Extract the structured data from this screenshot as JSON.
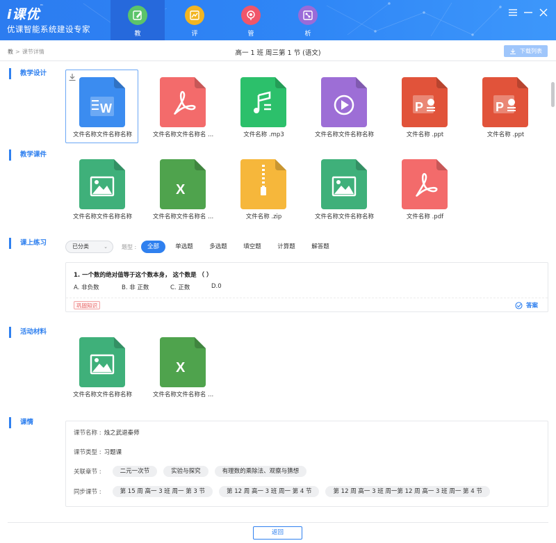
{
  "app": {
    "logo_main": "i课优",
    "logo_tm": "™",
    "logo_sub": "优课智能系统建设专家"
  },
  "nav": [
    {
      "label": "教",
      "color": "#5cc46a",
      "icon": "edit-icon"
    },
    {
      "label": "评",
      "color": "#f2b521",
      "icon": "chart-icon"
    },
    {
      "label": "管",
      "color": "#f0566a",
      "icon": "brain-icon"
    },
    {
      "label": "析",
      "color": "#9a6bd8",
      "icon": "analysis-icon"
    }
  ],
  "breadcrumb": {
    "root": "教",
    "sep": ">",
    "current": "课节详情"
  },
  "page_title": "高一 1 班 周三第 1 节 (语文)",
  "download_list_label": "下载列表",
  "sections": {
    "design": "教学设计",
    "courseware": "教学课件",
    "exercise": "课上练习",
    "activity": "活动材料",
    "situation": "课情"
  },
  "design_files": [
    {
      "name": "文件名称文件名称名称",
      "type": "word",
      "color": "#3b8cf0"
    },
    {
      "name": "文件名称文件名称名 ...",
      "type": "pdf",
      "color": "#f36b6b"
    },
    {
      "name": "文件名称 .mp3",
      "type": "audio",
      "color": "#2cc06b"
    },
    {
      "name": "文件名称文件名称名称",
      "type": "video",
      "color": "#9d6ed6"
    },
    {
      "name": "文件名称 .ppt",
      "type": "ppt",
      "color": "#e1533a"
    },
    {
      "name": "文件名称 .ppt",
      "type": "ppt",
      "color": "#e1533a"
    }
  ],
  "courseware_files": [
    {
      "name": "文件名称文件名称名称",
      "type": "image",
      "color": "#3fb07a"
    },
    {
      "name": "文件名称文件名称名 ...",
      "type": "excel",
      "color": "#4fa34d"
    },
    {
      "name": "文件名称 .zip",
      "type": "zip",
      "color": "#f6b73b"
    },
    {
      "name": "文件名称文件名称名称",
      "type": "image",
      "color": "#3fb07a"
    },
    {
      "name": "文件名称 .pdf",
      "type": "pdf",
      "color": "#f36b6b"
    }
  ],
  "activity_files": [
    {
      "name": "文件名称文件名称名称",
      "type": "image",
      "color": "#3fb07a"
    },
    {
      "name": "文件名称文件名称名 ...",
      "type": "excel",
      "color": "#4fa34d"
    }
  ],
  "exercise": {
    "category_select": "已分类",
    "type_label": "题型 :",
    "tabs": [
      "全部",
      "单选题",
      "多选题",
      "填空题",
      "计算题",
      "解答题"
    ],
    "question": "1. 一个数的绝对值等于这个数本身， 这个数是 （ ）",
    "options": [
      "A. 非负数",
      "B. 非 正数",
      "C. 正数",
      "D.0"
    ],
    "tag": "巩固知识",
    "answer_label": "答案"
  },
  "situation": {
    "name_label": "课节名称 :",
    "name_value": "烛之武退秦师",
    "type_label": "课节类型 :",
    "type_value": "习题课",
    "chapter_label": "关联章节 :",
    "chapters": [
      "二元一次节",
      "实验与探究",
      "有理数的乘除法、观察与猜想"
    ],
    "sync_label": "同步课节 :",
    "sync": [
      "第 15 周 高一 3 班 周一 第 3 节",
      "第 12 周 高一 3 班 周一 第 4 节",
      "第 12 周 高一 3 班 周一第 12 周 高一 3 班 周一 第 4 节"
    ]
  },
  "back_label": "返回"
}
